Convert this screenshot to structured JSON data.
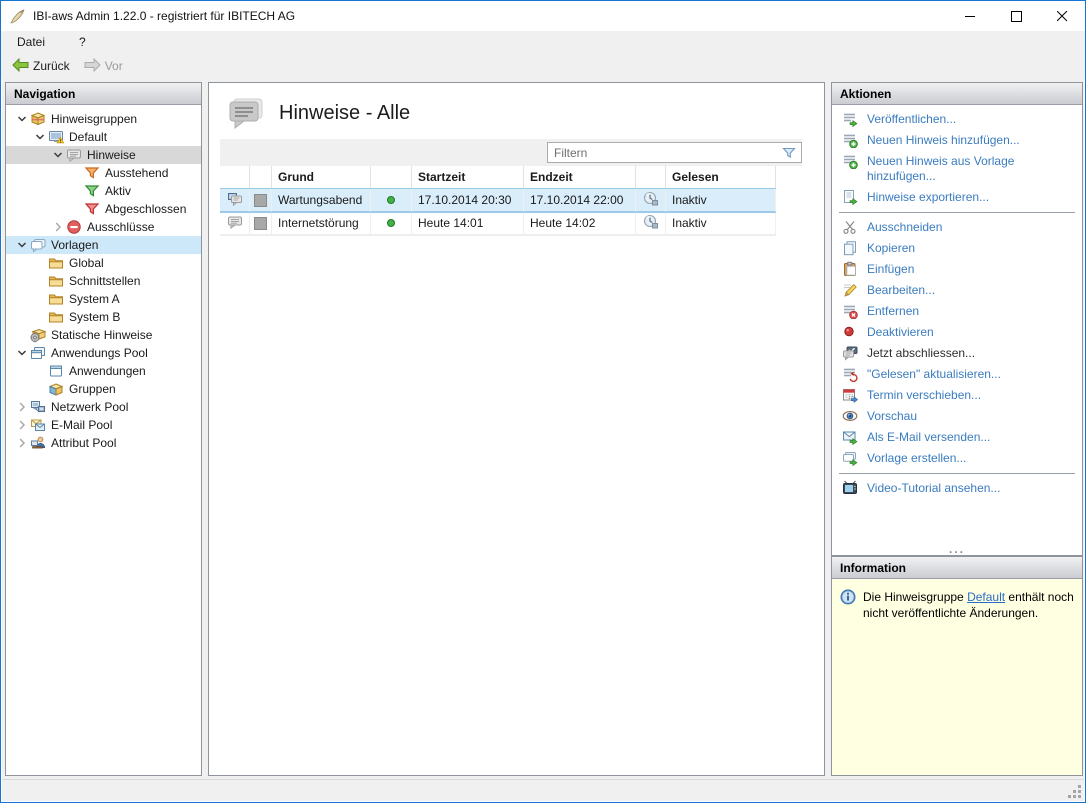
{
  "window": {
    "title": "IBI-aws Admin 1.22.0 - registriert für IBITECH AG",
    "controls": {
      "minimize": "minimize",
      "maximize": "maximize",
      "close": "close"
    }
  },
  "menubar": {
    "items": [
      {
        "label": "Datei"
      },
      {
        "label": "?"
      }
    ]
  },
  "toolbar": {
    "back_label": "Zurück",
    "forward_label": "Vor"
  },
  "navigation": {
    "header": "Navigation",
    "tree": [
      {
        "label": "Hinweisgruppen",
        "level": 0,
        "chevron": "expanded",
        "icon": "package-icon",
        "state": "none"
      },
      {
        "label": "Default",
        "level": 1,
        "chevron": "expanded",
        "icon": "monitor-warning-icon",
        "state": "none"
      },
      {
        "label": "Hinweise",
        "level": 2,
        "chevron": "expanded",
        "icon": "note-icon",
        "state": "selected"
      },
      {
        "label": "Ausstehend",
        "level": 3,
        "chevron": "none",
        "icon": "funnel-orange-icon",
        "state": "none"
      },
      {
        "label": "Aktiv",
        "level": 3,
        "chevron": "none",
        "icon": "funnel-green-icon",
        "state": "none"
      },
      {
        "label": "Abgeschlossen",
        "level": 3,
        "chevron": "none",
        "icon": "funnel-red-icon",
        "state": "none"
      },
      {
        "label": "Ausschlüsse",
        "level": 2,
        "chevron": "collapsed",
        "icon": "exclusion-icon",
        "state": "none"
      },
      {
        "label": "Vorlagen",
        "level": 0,
        "chevron": "expanded",
        "icon": "templates-icon",
        "state": "highlighted"
      },
      {
        "label": "Global",
        "level": 1,
        "chevron": "none",
        "icon": "folder-icon",
        "state": "none"
      },
      {
        "label": "Schnittstellen",
        "level": 1,
        "chevron": "none",
        "icon": "folder-icon",
        "state": "none"
      },
      {
        "label": "System A",
        "level": 1,
        "chevron": "none",
        "icon": "folder-icon",
        "state": "none"
      },
      {
        "label": "System B",
        "level": 1,
        "chevron": "none",
        "icon": "folder-icon",
        "state": "none"
      },
      {
        "label": "Statische Hinweise",
        "level": 0,
        "chevron": "none",
        "icon": "static-notes-icon",
        "state": "none"
      },
      {
        "label": "Anwendungs Pool",
        "level": 0,
        "chevron": "expanded",
        "icon": "app-pool-icon",
        "state": "none"
      },
      {
        "label": "Anwendungen",
        "level": 1,
        "chevron": "none",
        "icon": "application-icon",
        "state": "none"
      },
      {
        "label": "Gruppen",
        "level": 1,
        "chevron": "none",
        "icon": "groups-icon",
        "state": "none"
      },
      {
        "label": "Netzwerk Pool",
        "level": 0,
        "chevron": "collapsed",
        "icon": "network-icon",
        "state": "none"
      },
      {
        "label": "E-Mail Pool",
        "level": 0,
        "chevron": "collapsed",
        "icon": "mail-icon",
        "state": "none"
      },
      {
        "label": "Attribut Pool",
        "level": 0,
        "chevron": "collapsed",
        "icon": "attribute-icon",
        "state": "none"
      }
    ]
  },
  "main": {
    "title": "Hinweise - Alle",
    "filter_placeholder": "Filtern",
    "table": {
      "columns": [
        "",
        "",
        "Grund",
        "",
        "Startzeit",
        "Endzeit",
        "",
        "Gelesen"
      ],
      "rows": [
        {
          "note_icon": "note-displayed-icon",
          "color_swatch": "#a8a8a8",
          "grund": "Wartungsabend",
          "status_dot": "#44b04a",
          "startzeit": "17.10.2014 20:30",
          "endzeit": "17.10.2014 22:00",
          "read_icon": "read-clock-icon",
          "gelesen": "Inaktiv",
          "selected": true
        },
        {
          "note_icon": "note-icon",
          "color_swatch": "#a8a8a8",
          "grund": "Internetstörung",
          "status_dot": "#44b04a",
          "startzeit": "Heute 14:01",
          "endzeit": "Heute 14:02",
          "read_icon": "read-clock-icon",
          "gelesen": "Inaktiv",
          "selected": false
        }
      ]
    }
  },
  "actions": {
    "header": "Aktionen",
    "items": [
      {
        "label": "Veröffentlichen...",
        "icon": "publish-icon"
      },
      {
        "label": "Neuen Hinweis hinzufügen...",
        "icon": "add-note-icon"
      },
      {
        "label": "Neuen Hinweis aus Vorlage hinzufügen...",
        "icon": "add-note-icon"
      },
      {
        "label": "Hinweise exportieren...",
        "icon": "export-icon",
        "separator_after": true
      },
      {
        "label": "Ausschneiden",
        "icon": "cut-icon"
      },
      {
        "label": "Kopieren",
        "icon": "copy-icon"
      },
      {
        "label": "Einfügen",
        "icon": "paste-icon"
      },
      {
        "label": "Bearbeiten...",
        "icon": "edit-icon"
      },
      {
        "label": "Entfernen",
        "icon": "remove-icon"
      },
      {
        "label": "Deaktivieren",
        "icon": "deactivate-icon"
      },
      {
        "label": "Jetzt abschliessen...",
        "icon": "finish-icon",
        "disabled": true
      },
      {
        "label": "\"Gelesen\" aktualisieren...",
        "icon": "refresh-read-icon"
      },
      {
        "label": "Termin verschieben...",
        "icon": "reschedule-icon"
      },
      {
        "label": "Vorschau",
        "icon": "preview-icon"
      },
      {
        "label": "Als E-Mail versenden...",
        "icon": "send-email-icon"
      },
      {
        "label": "Vorlage erstellen...",
        "icon": "create-template-icon",
        "separator_after": true
      },
      {
        "label": "Video-Tutorial ansehen...",
        "icon": "video-tutorial-icon"
      }
    ]
  },
  "information": {
    "header": "Information",
    "text_before": "Die Hinweisgruppe ",
    "link_label": "Default",
    "text_after": " enthält noch nicht veröffentlichte Änderungen."
  },
  "colors": {
    "window_border": "#1574d2",
    "action_link": "#3a7cbf",
    "tree_selected_bg": "#d8d8d8",
    "tree_highlight_bg": "#cde8f9",
    "row_selected_bg": "#d9edfa",
    "info_bg": "#ffffe1",
    "status_dot_green": "#44b04a",
    "chrome_bg": "#f0f0f0"
  }
}
